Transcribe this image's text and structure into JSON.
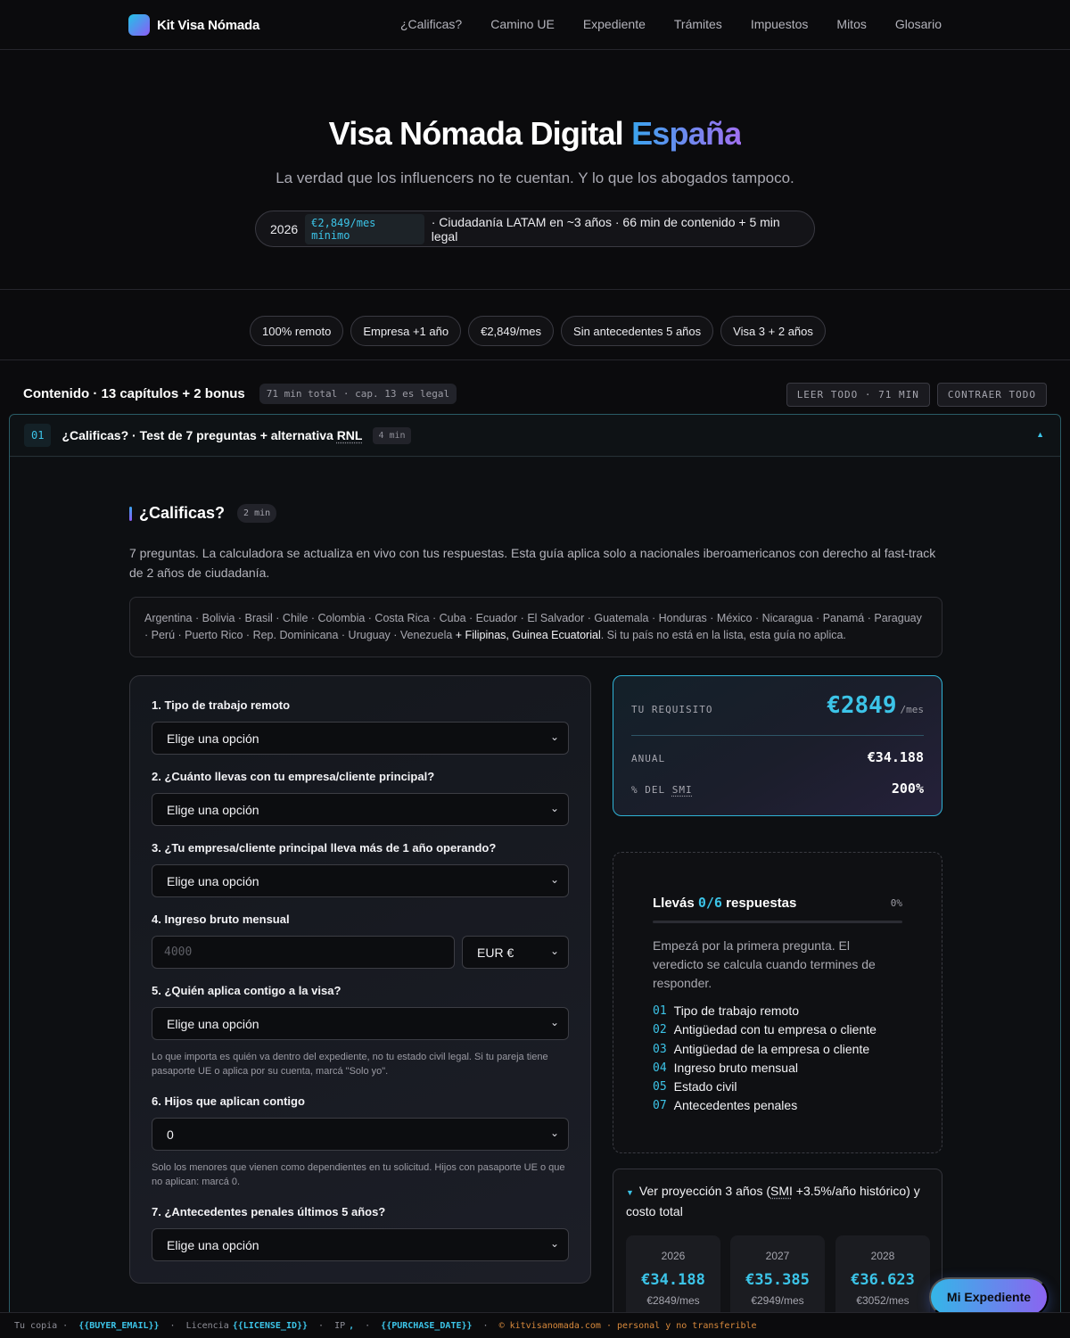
{
  "nav": {
    "brand": "Kit Visa Nómada",
    "links": [
      "¿Calificas?",
      "Camino UE",
      "Expediente",
      "Trámites",
      "Impuestos",
      "Mitos",
      "Glosario"
    ]
  },
  "hero": {
    "title_main": "Visa Nómada Digital",
    "title_accent": "España",
    "subtitle": "La verdad que los influencers no te cuentan. Y lo que los abogados tampoco.",
    "pill_year": "2026",
    "pill_tag": "€2,849/mes mínimo",
    "pill_rest": "· Ciudadanía LATAM en ~3 años · 66 min de contenido + 5 min legal"
  },
  "chips": [
    "100% remoto",
    "Empresa +1 año",
    "€2,849/mes",
    "Sin antecedentes 5 años",
    "Visa 3 + 2 años"
  ],
  "contents": {
    "title": "Contenido · 13 capítulos + 2 bonus",
    "badge": "71 min total · cap. 13 es legal",
    "read_all": "LEER TODO · 71 MIN",
    "collapse_all": "CONTRAER TODO"
  },
  "chapter": {
    "number": "01",
    "title_pre": "¿Calificas? · Test de 7 preguntas + alternativa ",
    "title_abbr": "RNL",
    "minutes": "4 min",
    "section_title": "¿Calificas?",
    "section_minutes": "2 min",
    "intro": "7 preguntas. La calculadora se actualiza en vivo con tus respuestas. Esta guía aplica solo a nacionales iberoamericanos con derecho al fast-track de 2 años de ciudadanía.",
    "countries": "Argentina · Bolivia · Brasil · Chile · Colombia · Costa Rica · Cuba · Ecuador · El Salvador · Guatemala · Honduras · México · Nicaragua · Panamá · Paraguay · Perú · Puerto Rico · Rep. Dominicana · Uruguay · Venezuela",
    "countries_extra": "+ Filipinas, Guinea Ecuatorial",
    "countries_note": ". Si tu país no está en la lista, esta guía no aplica."
  },
  "form": {
    "q1": "1. Tipo de trabajo remoto",
    "q2": "2. ¿Cuánto llevas con tu empresa/cliente principal?",
    "q3": "3. ¿Tu empresa/cliente principal lleva más de 1 año operando?",
    "q4": "4. Ingreso bruto mensual",
    "q5": "5. ¿Quién aplica contigo a la visa?",
    "q6": "6. Hijos que aplican contigo",
    "q7": "7. ¿Antecedentes penales últimos 5 años?",
    "select_placeholder": "Elige una opción",
    "income_placeholder": "4000",
    "currency": "EUR €",
    "children_value": "0",
    "help5": "Lo que importa es quién va dentro del expediente, no tu estado civil legal. Si tu pareja tiene pasaporte UE o aplica por su cuenta, marcá \"Solo yo\".",
    "help6": "Solo los menores que vienen como dependientes en tu solicitud. Hijos con pasaporte UE o que no aplican: marcá 0."
  },
  "requirement": {
    "label": "TU REQUISITO",
    "monthly": "€2849",
    "per": "/mes",
    "annual_label": "ANUAL",
    "annual_value": "€34.188",
    "smi_label_pre": "% DEL ",
    "smi_label_abbr": "SMI",
    "smi_value": "200%"
  },
  "progress": {
    "title_pre": "Llevás ",
    "count": "0/6",
    "title_post": " respuestas",
    "percent_text": "0%",
    "percent": 0,
    "text": "Empezá por la primera pregunta. El veredicto se calcula cuando termines de responder.",
    "items": [
      {
        "n": "01",
        "label": "Tipo de trabajo remoto"
      },
      {
        "n": "02",
        "label": "Antigüedad con tu empresa o cliente"
      },
      {
        "n": "03",
        "label": "Antigüedad de la empresa o cliente"
      },
      {
        "n": "04",
        "label": "Ingreso bruto mensual"
      },
      {
        "n": "05",
        "label": "Estado civil"
      },
      {
        "n": "07",
        "label": "Antecedentes penales"
      }
    ]
  },
  "projection": {
    "head_pre": "Ver proyección 3 años (",
    "head_abbr": "SMI",
    "head_post": " +3.5%/año histórico) y costo total",
    "years": [
      {
        "year": "2026",
        "annual": "€34.188",
        "monthly": "€2849/mes"
      },
      {
        "year": "2027",
        "annual": "€35.385",
        "monthly": "€2949/mes"
      },
      {
        "year": "2028",
        "annual": "€36.623",
        "monthly": "€3052/mes"
      }
    ]
  },
  "fab": "Mi Expediente",
  "footer": {
    "copy_label": "Tu copia ·",
    "buyer": "{{BUYER_EMAIL}}",
    "license_label": "Licencia",
    "license": "{{LICENSE_ID}}",
    "ip_label": "IP",
    "ip_sep": ",",
    "purchase": "{{PURCHASE_DATE}}",
    "domain": "© kitvisanomada.com · personal y no transferible"
  },
  "colors": {
    "accent": "#3cc4e8",
    "accent2": "#8b5cf6",
    "background": "#0b0b0d"
  }
}
